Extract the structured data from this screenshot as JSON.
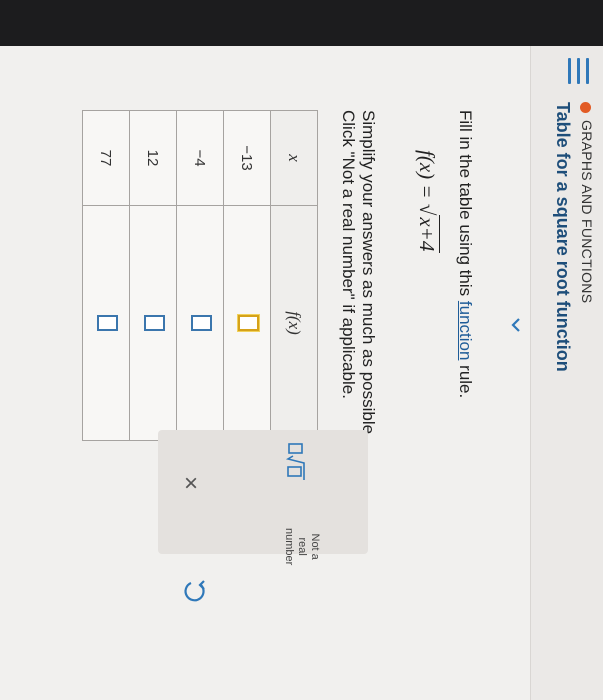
{
  "header": {
    "category": "GRAPHS AND FUNCTIONS",
    "title": "Table for a square root function"
  },
  "problem": {
    "instruction_prefix": "Fill in the table using this ",
    "instruction_link": "function",
    "instruction_suffix": " rule.",
    "formula_lhs": "f(x) =",
    "formula_radicand": "x+4",
    "simplify_line1": "Simplify your answers as much as possible.",
    "simplify_line2": "Click \"Not a real number\" if applicable."
  },
  "table": {
    "col_x": "x",
    "col_fx": "f(x)",
    "rows": [
      {
        "x": "−13"
      },
      {
        "x": "−4"
      },
      {
        "x": "12"
      },
      {
        "x": "77"
      }
    ]
  },
  "panel": {
    "not_real_line1": "Not a",
    "not_real_line2": "real",
    "not_real_line3": "number",
    "times": "×"
  },
  "colors": {
    "accent": "#2f78b9",
    "status_dot": "#e25b25",
    "title": "#1e4e7a"
  }
}
